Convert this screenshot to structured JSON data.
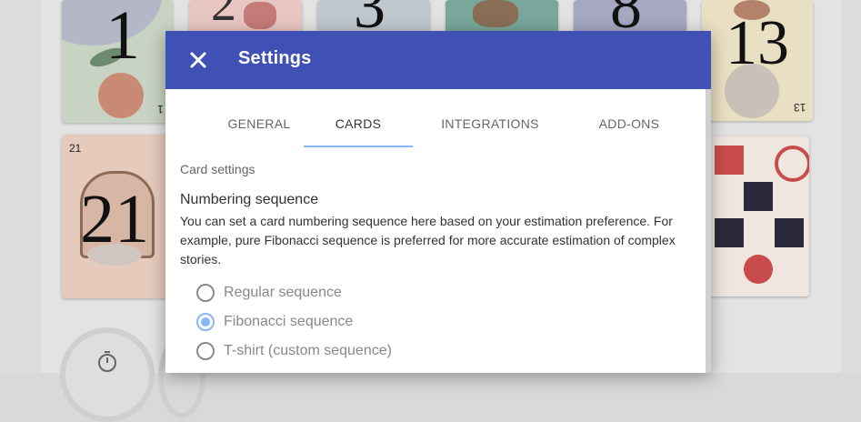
{
  "dialog": {
    "title": "Settings",
    "close_icon": "close-icon"
  },
  "tabs": [
    {
      "label": "GENERAL",
      "active": false
    },
    {
      "label": "CARDS",
      "active": true
    },
    {
      "label": "INTEGRATIONS",
      "active": false
    },
    {
      "label": "ADD-ONS",
      "active": false
    }
  ],
  "content": {
    "section_label": "Card settings",
    "heading": "Numbering sequence",
    "description": "You can set a card numbering sequence here based on your estimation preference. For example, pure Fibonacci sequence is preferred for more accurate estimation of complex stories.",
    "options": [
      {
        "label": "Regular sequence",
        "checked": false
      },
      {
        "label": "Fibonacci sequence",
        "checked": true
      },
      {
        "label": "T-shirt (custom sequence)",
        "checked": false
      }
    ]
  },
  "background_cards": {
    "card_1": "1",
    "card_13": "13",
    "card_21": "21",
    "card_21_corner": "21",
    "card_13_corner": "13",
    "card_1_corner": "1",
    "card_8": "8",
    "card_3": "3",
    "card_2": "2"
  },
  "colors": {
    "header": "#3f51b5",
    "accent": "#8ab4f8"
  }
}
